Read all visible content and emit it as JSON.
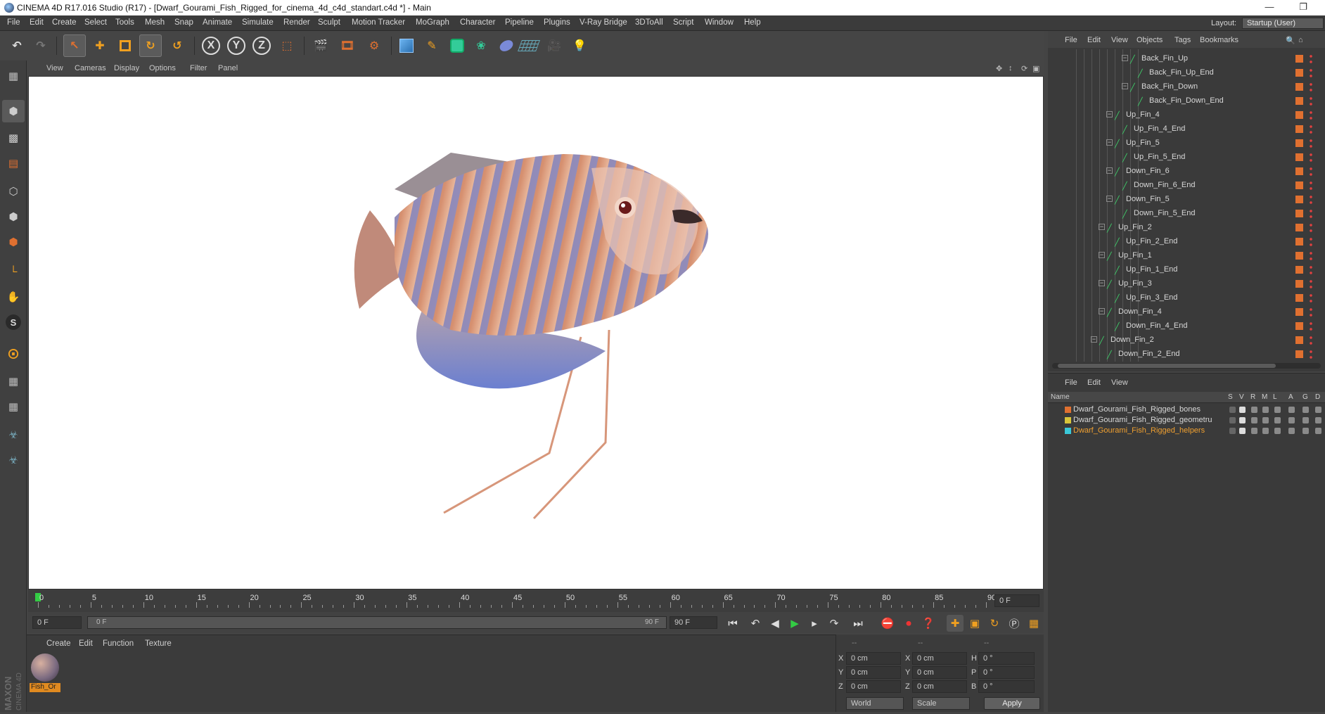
{
  "window": {
    "title": "CINEMA 4D R17.016 Studio (R17) - [Dwarf_Gourami_Fish_Rigged_for_cinema_4d_c4d_standart.c4d *] - Main",
    "minimize": "—",
    "restore": "❐"
  },
  "menubar": {
    "items": [
      "File",
      "Edit",
      "Create",
      "Select",
      "Tools",
      "Mesh",
      "Snap",
      "Animate",
      "Simulate",
      "Render",
      "Sculpt",
      "Motion Tracker",
      "MoGraph",
      "Character",
      "Pipeline",
      "Plugins",
      "V-Ray Bridge",
      "3DToAll",
      "Script",
      "Window",
      "Help"
    ],
    "layout_label": "Layout:",
    "layout_value": "Startup (User)"
  },
  "toolbar": {
    "axis_x": "X",
    "axis_y": "Y",
    "axis_z": "Z",
    "icons": [
      "undo-icon",
      "redo-icon",
      "select-arrow-icon",
      "move-icon",
      "scale-icon",
      "rotate-icon",
      "recent-tool-icon",
      "x-axis-icon",
      "y-axis-icon",
      "z-axis-icon",
      "world-coord-icon",
      "render-view-icon",
      "render-picture-viewer-icon",
      "render-settings-icon",
      "cube-icon",
      "pen-icon",
      "subdivision-icon",
      "array-icon",
      "deformer-icon",
      "floor-icon",
      "camera-icon",
      "light-icon"
    ]
  },
  "leftbar": {
    "icons": [
      "make-editable-icon",
      "model-mode-icon",
      "texture-mode-icon",
      "workplane-icon",
      "points-mode-icon",
      "edges-mode-icon",
      "polygons-mode-icon",
      "axis-mode-icon",
      "tweak-icon",
      "solo-icon",
      "snap-icon",
      "enable-snap-icon",
      "locked-workplane-icon",
      "python-icon",
      "python-console-icon"
    ],
    "s_label": "S"
  },
  "viewport": {
    "menu": [
      "View",
      "Cameras",
      "Display",
      "Options",
      "Filter",
      "Panel"
    ]
  },
  "timeline": {
    "labels": [
      "0",
      "5",
      "10",
      "15",
      "20",
      "25",
      "30",
      "35",
      "40",
      "45",
      "50",
      "55",
      "60",
      "65",
      "70",
      "75",
      "80",
      "85",
      "90"
    ],
    "current_frame_field": "0 F"
  },
  "playback": {
    "start_field": "0 F",
    "range_left": "0 F",
    "range_right": "90 F",
    "end_field": "90 F"
  },
  "materials": {
    "menu": [
      "Create",
      "Edit",
      "Function",
      "Texture"
    ],
    "items": [
      {
        "name": "Fish_Or"
      }
    ]
  },
  "coords": {
    "header_left": "--",
    "header_mid": "--",
    "header_right": "--",
    "rows": [
      {
        "a": "X",
        "av": "0 cm",
        "b": "X",
        "bv": "0 cm",
        "c": "H",
        "cv": "0 °"
      },
      {
        "a": "Y",
        "av": "0 cm",
        "b": "Y",
        "bv": "0 cm",
        "c": "P",
        "cv": "0 °"
      },
      {
        "a": "Z",
        "av": "0 cm",
        "b": "Z",
        "bv": "0 cm",
        "c": "B",
        "cv": "0 °"
      }
    ],
    "world": "World",
    "scale": "Scale",
    "apply": "Apply"
  },
  "objects": {
    "menu": [
      "File",
      "Edit",
      "View",
      "Objects",
      "Tags",
      "Bookmarks"
    ],
    "rows": [
      {
        "name": "Back_Fin_Up",
        "depth": 7,
        "expand": true
      },
      {
        "name": "Back_Fin_Up_End",
        "depth": 8,
        "expand": false
      },
      {
        "name": "Back_Fin_Down",
        "depth": 7,
        "expand": true
      },
      {
        "name": "Back_Fin_Down_End",
        "depth": 8,
        "expand": false
      },
      {
        "name": "Up_Fin_4",
        "depth": 5,
        "expand": true
      },
      {
        "name": "Up_Fin_4_End",
        "depth": 6,
        "expand": false
      },
      {
        "name": "Up_Fin_5",
        "depth": 5,
        "expand": true
      },
      {
        "name": "Up_Fin_5_End",
        "depth": 6,
        "expand": false
      },
      {
        "name": "Down_Fin_6",
        "depth": 5,
        "expand": true
      },
      {
        "name": "Down_Fin_6_End",
        "depth": 6,
        "expand": false
      },
      {
        "name": "Down_Fin_5",
        "depth": 5,
        "expand": true
      },
      {
        "name": "Down_Fin_5_End",
        "depth": 6,
        "expand": false
      },
      {
        "name": "Up_Fin_2",
        "depth": 4,
        "expand": true
      },
      {
        "name": "Up_Fin_2_End",
        "depth": 5,
        "expand": false
      },
      {
        "name": "Up_Fin_1",
        "depth": 4,
        "expand": true
      },
      {
        "name": "Up_Fin_1_End",
        "depth": 5,
        "expand": false
      },
      {
        "name": "Up_Fin_3",
        "depth": 4,
        "expand": true
      },
      {
        "name": "Up_Fin_3_End",
        "depth": 5,
        "expand": false
      },
      {
        "name": "Down_Fin_4",
        "depth": 4,
        "expand": true
      },
      {
        "name": "Down_Fin_4_End",
        "depth": 5,
        "expand": false
      },
      {
        "name": "Down_Fin_2",
        "depth": 3,
        "expand": true
      },
      {
        "name": "Down_Fin_2_End",
        "depth": 4,
        "expand": false
      }
    ]
  },
  "layers": {
    "menu": [
      "File",
      "Edit",
      "View"
    ],
    "columns": [
      "Name",
      "S",
      "V",
      "R",
      "M",
      "L",
      "A",
      "G",
      "D"
    ],
    "rows": [
      {
        "name": "Dwarf_Gourami_Fish_Rigged_bones",
        "color": "#e07030",
        "selected": false
      },
      {
        "name": "Dwarf_Gourami_Fish_Rigged_geometru",
        "color": "#d8c43a",
        "selected": false
      },
      {
        "name": "Dwarf_Gourami_Fish_Rigged_helpers",
        "color": "#3ac8d8",
        "selected": true
      }
    ]
  },
  "brand": {
    "maxon": "MAXON",
    "c4d": "CINEMA 4D"
  },
  "colors": {
    "accent": "#e07030",
    "selected_text": "#f0a030",
    "bone": "#3fcf6a"
  }
}
